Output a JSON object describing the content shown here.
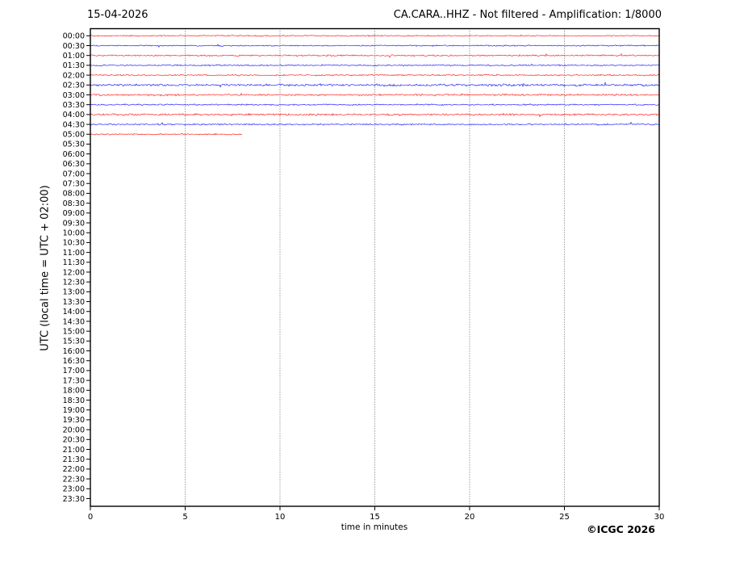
{
  "titles": {
    "date": "15-04-2026",
    "station": "CA.CARA..HHZ - Not filtered - Amplification: 1/8000"
  },
  "axes": {
    "ylabel": "UTC (local time = UTC + 02:00)",
    "xlabel": "time in minutes"
  },
  "copyright": "©ICGC 2026",
  "chart_data": {
    "type": "line",
    "subtype": "helicorder-daily-seismogram",
    "title": "CA.CARA..HHZ - Not filtered - Amplification: 1/8000",
    "date": "15-04-2026",
    "xlabel": "time in minutes",
    "ylabel": "UTC (local time = UTC + 02:00)",
    "xlim": [
      0,
      30
    ],
    "x_ticks": [
      0,
      5,
      10,
      15,
      20,
      25,
      30
    ],
    "x_gridlines": [
      5,
      10,
      15,
      20,
      25
    ],
    "grid": "vertical dotted gridlines, full plot height",
    "legend": "none",
    "row_labels": [
      "00:00",
      "00:30",
      "01:00",
      "01:30",
      "02:00",
      "02:30",
      "03:00",
      "03:30",
      "04:00",
      "04:30",
      "05:00",
      "05:30",
      "06:00",
      "06:30",
      "07:00",
      "07:30",
      "08:00",
      "08:30",
      "09:00",
      "09:30",
      "10:00",
      "10:30",
      "11:00",
      "11:30",
      "12:00",
      "12:30",
      "13:00",
      "13:30",
      "14:00",
      "14:30",
      "15:00",
      "15:30",
      "16:00",
      "16:30",
      "17:00",
      "17:30",
      "18:00",
      "18:30",
      "19:00",
      "19:30",
      "20:00",
      "20:30",
      "21:00",
      "21:30",
      "22:00",
      "22:30",
      "23:00",
      "23:30"
    ],
    "colors": {
      "trace_red": "#ff0000",
      "trace_blue": "#0000ff",
      "grid": "#444444",
      "frame": "#000000",
      "background": "#ffffff"
    },
    "traces": [
      {
        "label": "00:00",
        "row": 0,
        "color": "red",
        "start_min": 0,
        "end_min": 30,
        "amp": 0.7
      },
      {
        "label": "00:30",
        "row": 1,
        "color": "blue",
        "start_min": 0,
        "end_min": 30,
        "amp": 0.7
      },
      {
        "label": "01:00",
        "row": 2,
        "color": "red",
        "start_min": 0,
        "end_min": 30,
        "amp": 0.9
      },
      {
        "label": "01:30",
        "row": 3,
        "color": "blue",
        "start_min": 0,
        "end_min": 30,
        "amp": 0.8
      },
      {
        "label": "02:00",
        "row": 4,
        "color": "red",
        "start_min": 0,
        "end_min": 30,
        "amp": 0.8
      },
      {
        "label": "02:30",
        "row": 5,
        "color": "blue",
        "start_min": 0,
        "end_min": 30,
        "amp": 1.3
      },
      {
        "label": "03:00",
        "row": 6,
        "color": "red",
        "start_min": 0,
        "end_min": 30,
        "amp": 1.0
      },
      {
        "label": "03:30",
        "row": 7,
        "color": "blue",
        "start_min": 0,
        "end_min": 30,
        "amp": 0.8
      },
      {
        "label": "04:00",
        "row": 8,
        "color": "red",
        "start_min": 0,
        "end_min": 30,
        "amp": 1.1
      },
      {
        "label": "04:30",
        "row": 9,
        "color": "blue",
        "start_min": 0,
        "end_min": 30,
        "amp": 0.9
      },
      {
        "label": "05:00",
        "row": 10,
        "color": "red",
        "start_min": 0,
        "end_min": 8,
        "amp": 0.8
      }
    ],
    "empty_rows": "05:30 through 23:30 contain no trace data"
  }
}
